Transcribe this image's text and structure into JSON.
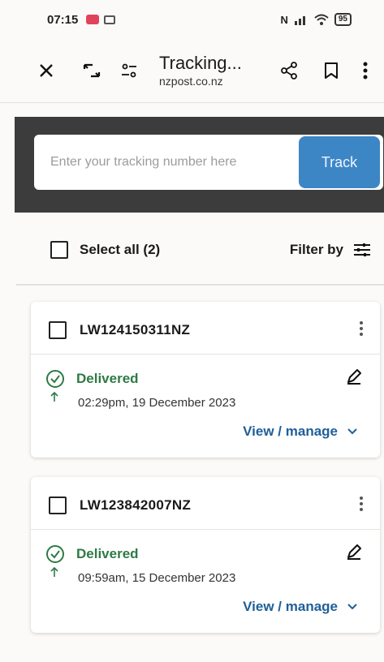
{
  "status_bar": {
    "time": "07:15",
    "right_text": "N",
    "battery": "95"
  },
  "app_bar": {
    "title": "Tracking...",
    "url": "nzpost.co.nz",
    "icons": [
      "close-icon",
      "tab-switch-icon",
      "site-settings-icon",
      "share-icon",
      "bookmark-icon",
      "more-icon"
    ]
  },
  "search": {
    "placeholder": "Enter your tracking number here",
    "value": "",
    "button_label": "Track"
  },
  "list_controls": {
    "select_all_label": "Select all (2)",
    "filter_label": "Filter by"
  },
  "parcels": [
    {
      "tracking_number": "LW124150311NZ",
      "status": "Delivered",
      "datetime": "02:29pm, 19 December 2023",
      "action_label": "View / manage"
    },
    {
      "tracking_number": "LW123842007NZ",
      "status": "Delivered",
      "datetime": "09:59am, 15 December 2023",
      "action_label": "View / manage"
    }
  ],
  "colors": {
    "track_button": "#3d86c6",
    "status_delivered": "#2e7a45",
    "link": "#1f5f98",
    "search_band": "#3c3c3c"
  }
}
